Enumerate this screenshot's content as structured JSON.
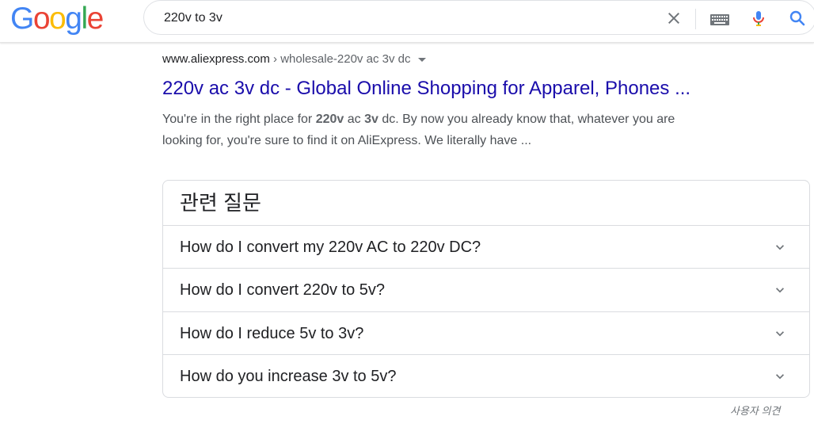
{
  "header": {
    "logo_letters": [
      {
        "ch": "G",
        "color": "#4285F4"
      },
      {
        "ch": "o",
        "color": "#EA4335"
      },
      {
        "ch": "o",
        "color": "#FBBC05"
      },
      {
        "ch": "g",
        "color": "#4285F4"
      },
      {
        "ch": "l",
        "color": "#34A853"
      },
      {
        "ch": "e",
        "color": "#EA4335"
      }
    ],
    "search_query": "220v to 3v",
    "icons": [
      "clear-icon",
      "keyboard-icon",
      "mic-icon",
      "search-icon"
    ]
  },
  "result": {
    "domain": "www.aliexpress.com",
    "path": " › wholesale-220v ac 3v dc",
    "title": "220v ac 3v dc - Global Online Shopping for Apparel, Phones ...",
    "snippet_line1": [
      {
        "text": "You're in the right place for ",
        "bold": false
      },
      {
        "text": "220v",
        "bold": true
      },
      {
        "text": " ac ",
        "bold": false
      },
      {
        "text": "3v",
        "bold": true
      },
      {
        "text": " dc. By now you already know that, whatever you are",
        "bold": false
      }
    ],
    "snippet_line2": "looking for, you're sure to find it on AliExpress. We literally have ..."
  },
  "related_questions": {
    "heading": "관련 질문",
    "items": [
      "How do I convert my 220v AC to 220v DC?",
      "How do I convert 220v to 5v?",
      "How do I reduce 5v to 3v?",
      "How do you increase 3v to 5v?"
    ]
  },
  "feedback_label": "사용자 의견",
  "colors": {
    "link": "#1a0dab",
    "snippet": "#4d5156",
    "border": "#dadce0"
  }
}
